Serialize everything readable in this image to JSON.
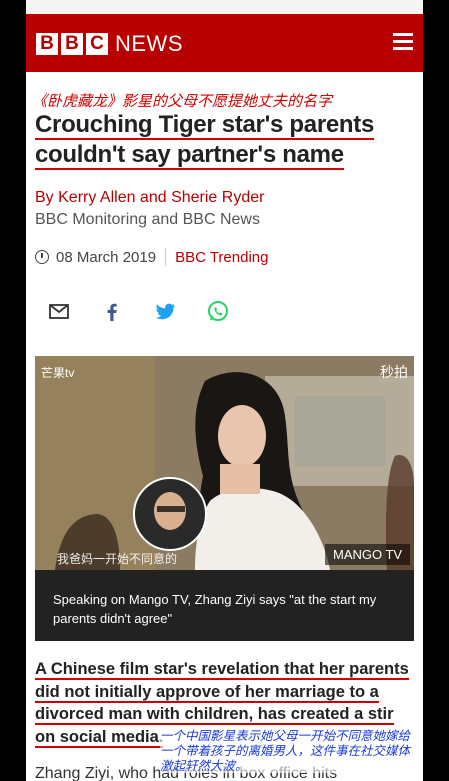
{
  "header": {
    "logo_letters": [
      "B",
      "B",
      "C"
    ],
    "logo_word": "NEWS",
    "menu_icon": "hamburger-menu-icon",
    "brand_color": "#b80000"
  },
  "annotation_top": "《卧虎藏龙》影星的父母不愿提她丈夫的名字",
  "article": {
    "headline_line1": "Crouching Tiger star's parents",
    "headline_line2": "couldn't say partner's name",
    "byline": "By Kerry Allen and Sherie Ryder",
    "source": "BBC Monitoring and BBC News",
    "date": "08 March 2019",
    "category": "BBC Trending",
    "share_icons": [
      "email-icon",
      "facebook-icon",
      "twitter-icon",
      "whatsapp-icon"
    ]
  },
  "media": {
    "top_left_logo": "芒果tv",
    "top_right_logo": "秒拍",
    "subtitle": "我爸妈一开始不同意的",
    "badge": "MANGO TV",
    "caption": "Speaking on Mango TV, Zhang Ziyi says \"at the start my parents didn't agree\""
  },
  "lead_paragraph": "A Chinese film star's revelation that her parents did not initially approve of her marriage to a divorced man with children, has created a stir on social media.",
  "annotation_bottom": "一个中国影星表示她父母一开始不同意她嫁给一个带着孩子的离婚男人，这件事在社交媒体激起轩然大波。",
  "body_start": "Zhang Ziyi, who had roles in box office hits"
}
